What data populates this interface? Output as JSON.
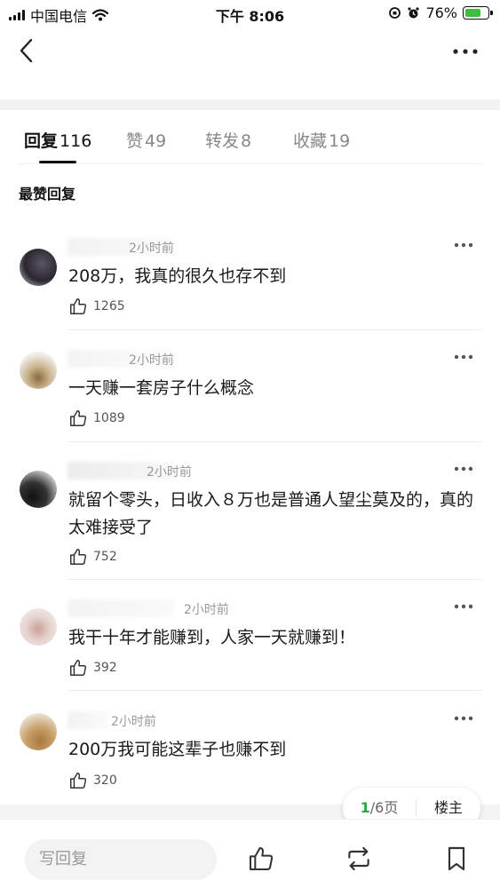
{
  "status_bar": {
    "carrier": "中国电信",
    "time": "下午 8:06",
    "battery": "76%",
    "battery_level": 0.76
  },
  "tabs": [
    {
      "label": "回复",
      "count": "116"
    },
    {
      "label": "赞",
      "count": "49"
    },
    {
      "label": "转发",
      "count": "8"
    },
    {
      "label": "收藏",
      "count": "19"
    }
  ],
  "section_title": "最赞回复",
  "comments": [
    {
      "time": "2小时前",
      "text": "208万，我真的很久也存不到",
      "likes": "1265"
    },
    {
      "time": "2小时前",
      "text": "一天赚一套房子什么概念",
      "likes": "1089"
    },
    {
      "time": "2小时前",
      "text": "就留个零头，日收入８万也是普通人望尘莫及的，真的太难接受了",
      "likes": "752"
    },
    {
      "time": "2小时前",
      "text": "我干十年才能赚到，人家一天就赚到！",
      "likes": "392"
    },
    {
      "time": "2小时前",
      "text": "200万我可能这辈子也赚不到",
      "likes": "320"
    }
  ],
  "pagination": {
    "current": "1",
    "total": "/6页",
    "owner_label": "楼主"
  },
  "bottom_bar": {
    "reply_placeholder": "写回复"
  }
}
